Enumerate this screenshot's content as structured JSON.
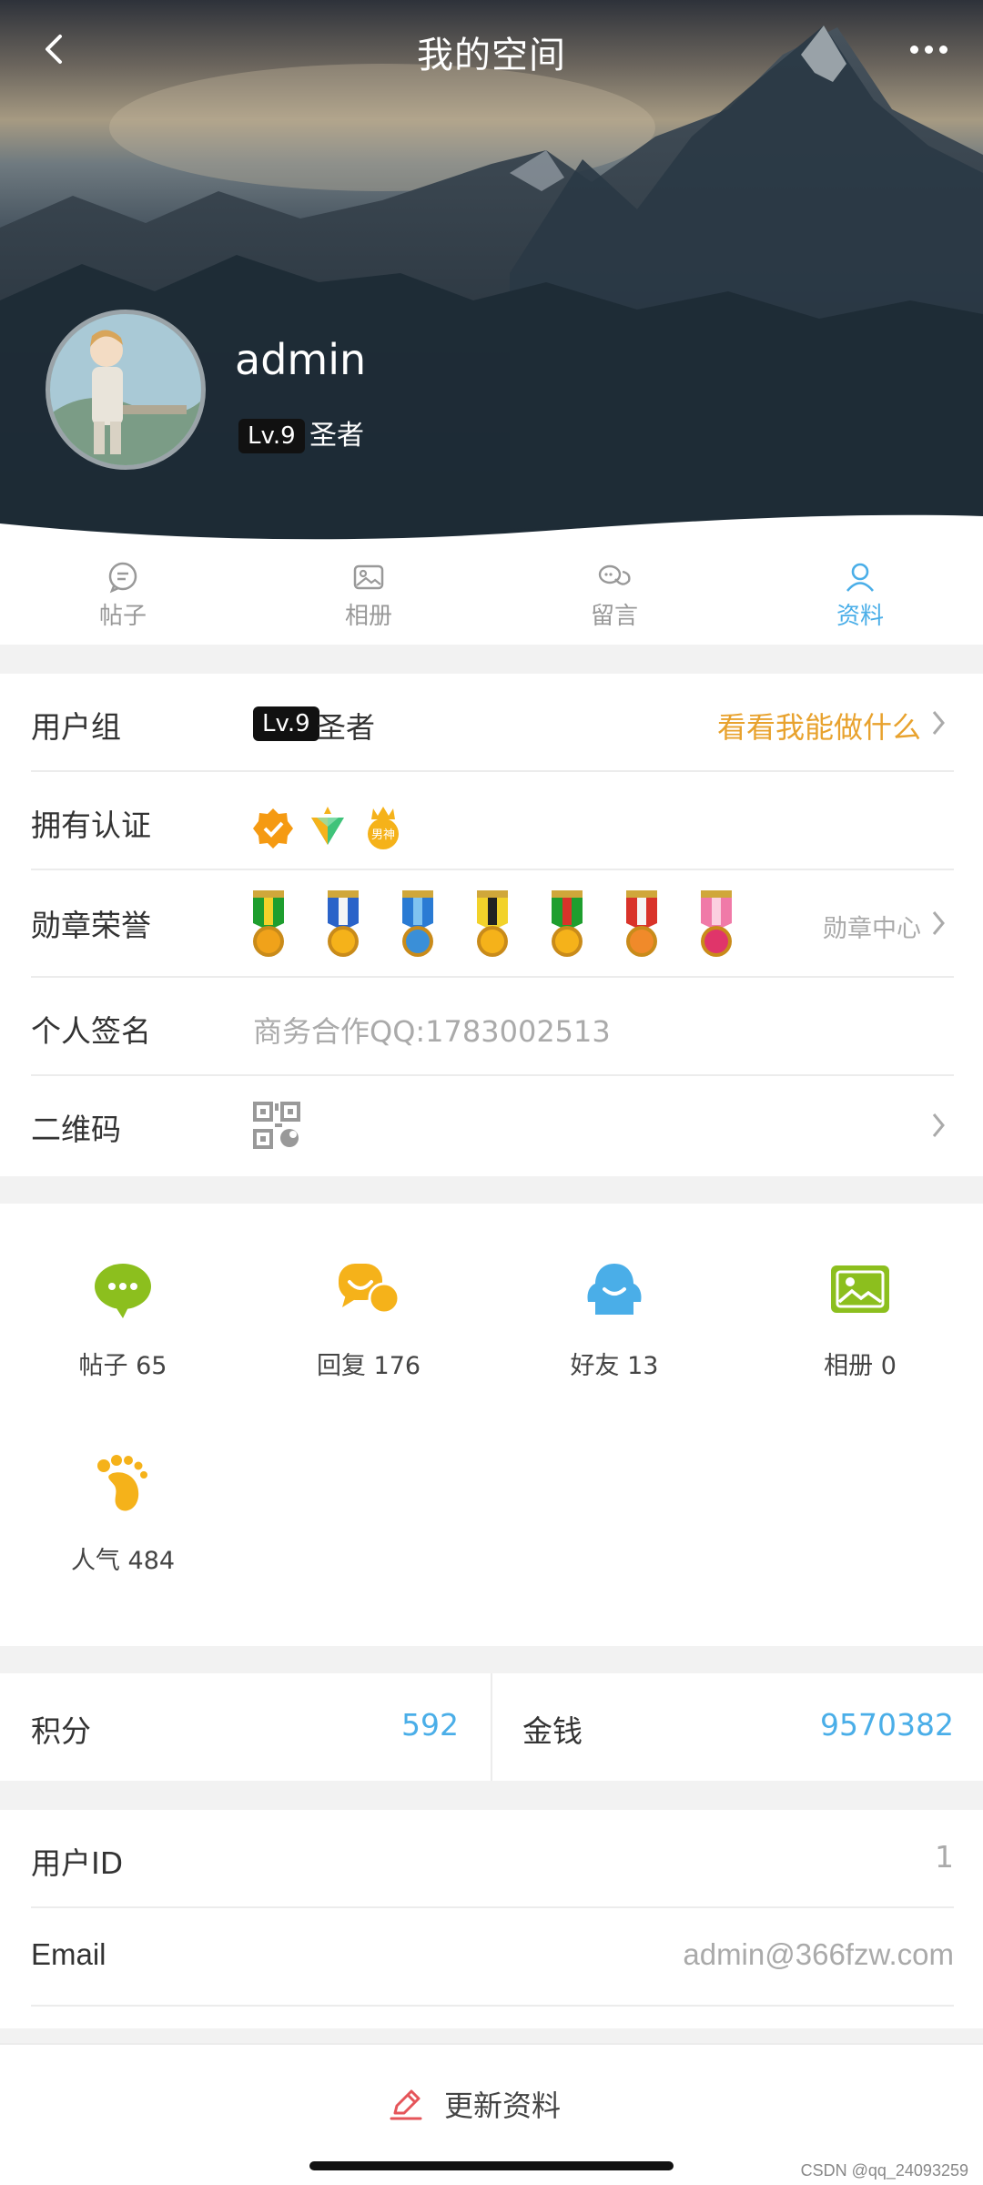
{
  "header": {
    "title": "我的空间",
    "back_icon": "chevron-left-icon",
    "more_icon": "more-dots-icon"
  },
  "profile": {
    "username": "admin",
    "level": "Lv.9",
    "rank": "圣者"
  },
  "tabs": [
    {
      "label": "帖子",
      "icon": "chat-bubble-icon",
      "active": false
    },
    {
      "label": "相册",
      "icon": "photo-icon",
      "active": false
    },
    {
      "label": "留言",
      "icon": "messages-icon",
      "active": false
    },
    {
      "label": "资料",
      "icon": "user-icon",
      "active": true
    }
  ],
  "info": {
    "group": {
      "label": "用户组",
      "level": "Lv.9",
      "rank": "圣者",
      "link": "看看我能做什么"
    },
    "certs": {
      "label": "拥有认证",
      "badges": [
        "verified-badge-icon",
        "diamond-badge-icon",
        "男神"
      ]
    },
    "medals": {
      "label": "勋章荣誉",
      "link": "勋章中心",
      "count": 7
    },
    "signature": {
      "label": "个人签名",
      "value": "商务合作QQ:1783002513"
    },
    "qrcode": {
      "label": "二维码"
    }
  },
  "stats": [
    {
      "label": "帖子 65",
      "icon": "post-bubble-icon",
      "color": "#8cbf1e"
    },
    {
      "label": "回复 176",
      "icon": "reply-bubble-icon",
      "color": "#f5b21a"
    },
    {
      "label": "好友 13",
      "icon": "friends-icon",
      "color": "#4aaee8"
    },
    {
      "label": "相册 0",
      "icon": "album-icon",
      "color": "#8cbf1e"
    },
    {
      "label": "人气 484",
      "icon": "footprint-icon",
      "color": "#f5b21a"
    }
  ],
  "points": {
    "score_label": "积分",
    "score_value": "592",
    "money_label": "金钱",
    "money_value": "9570382"
  },
  "details": [
    {
      "label": "用户ID",
      "value": "1"
    },
    {
      "label": "Email",
      "value": "admin@366fzw.com"
    }
  ],
  "bottom": {
    "update_label": "更新资料",
    "watermark": "CSDN @qq_24093259"
  },
  "colors": {
    "accent_blue": "#4aaee8",
    "gold": "#e8a22e",
    "green": "#8cbf1e",
    "orange": "#f5b21a",
    "update_icon_red": "#e5555a"
  }
}
